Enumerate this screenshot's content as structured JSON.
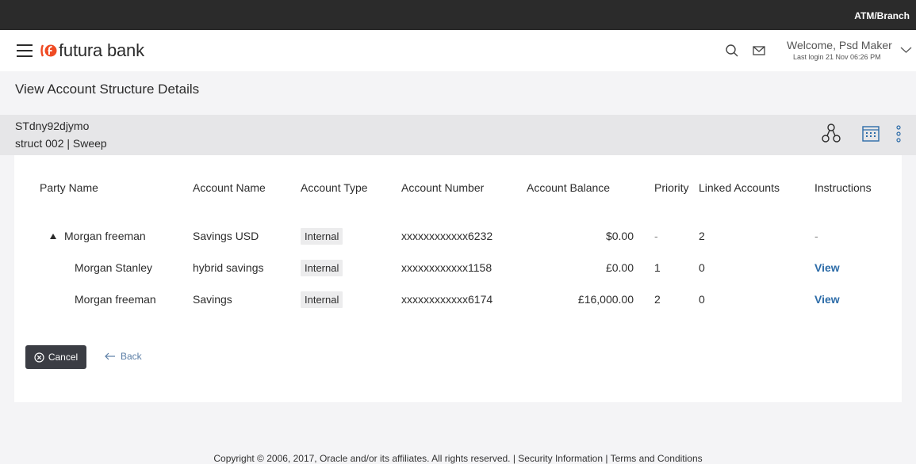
{
  "topbar": {
    "location_label": "ATM/Branch"
  },
  "header": {
    "brand_name": "futura bank",
    "welcome_text": "Welcome, Psd Maker",
    "last_login": "Last login 21 Nov 06:26 PM"
  },
  "page": {
    "title": "View Account Structure Details"
  },
  "structure": {
    "id": "STdny92djymo",
    "subtitle": "struct 002 | Sweep"
  },
  "table": {
    "headers": {
      "party_name": "Party Name",
      "account_name": "Account Name",
      "account_type": "Account Type",
      "account_number": "Account Number",
      "account_balance": "Account Balance",
      "priority": "Priority",
      "linked_accounts": "Linked Accounts",
      "instructions": "Instructions"
    },
    "rows": [
      {
        "party_name": "Morgan freeman",
        "account_name": "Savings USD",
        "account_type": "Internal",
        "account_number": "xxxxxxxxxxxx6232",
        "account_balance": "$0.00",
        "priority": "-",
        "linked_accounts": "2",
        "instructions": "-"
      },
      {
        "party_name": "Morgan Stanley",
        "account_name": "hybrid savings",
        "account_type": "Internal",
        "account_number": "xxxxxxxxxxxx1158",
        "account_balance": "£0.00",
        "priority": "1",
        "linked_accounts": "0",
        "instructions": "View"
      },
      {
        "party_name": "Morgan freeman",
        "account_name": "Savings",
        "account_type": "Internal",
        "account_number": "xxxxxxxxxxxx6174",
        "account_balance": "£16,000.00",
        "priority": "2",
        "linked_accounts": "0",
        "instructions": "View"
      }
    ]
  },
  "actions": {
    "cancel_label": "Cancel",
    "back_label": "Back"
  },
  "footer": {
    "text": "Copyright © 2006, 2017, Oracle and/or its affiliates. All rights reserved. | Security Information | Terms and Conditions"
  },
  "colors": {
    "topbar_bg": "#2b2b2b",
    "brand_orange": "#ef4b24",
    "link_blue": "#2d6ca8",
    "button_dark": "#3b3d44",
    "band_grey": "#e6e6e8"
  },
  "icons": {
    "menu": "hamburger-icon",
    "search": "search-icon",
    "mail": "mail-icon",
    "user_menu": "chevron-down-icon",
    "tree_view": "tree-structure-icon",
    "list_view": "grid-list-icon",
    "more": "more-vertical-icon",
    "expand": "triangle-expanded-icon",
    "cancel": "close-circle-icon",
    "back": "arrow-left-icon"
  }
}
